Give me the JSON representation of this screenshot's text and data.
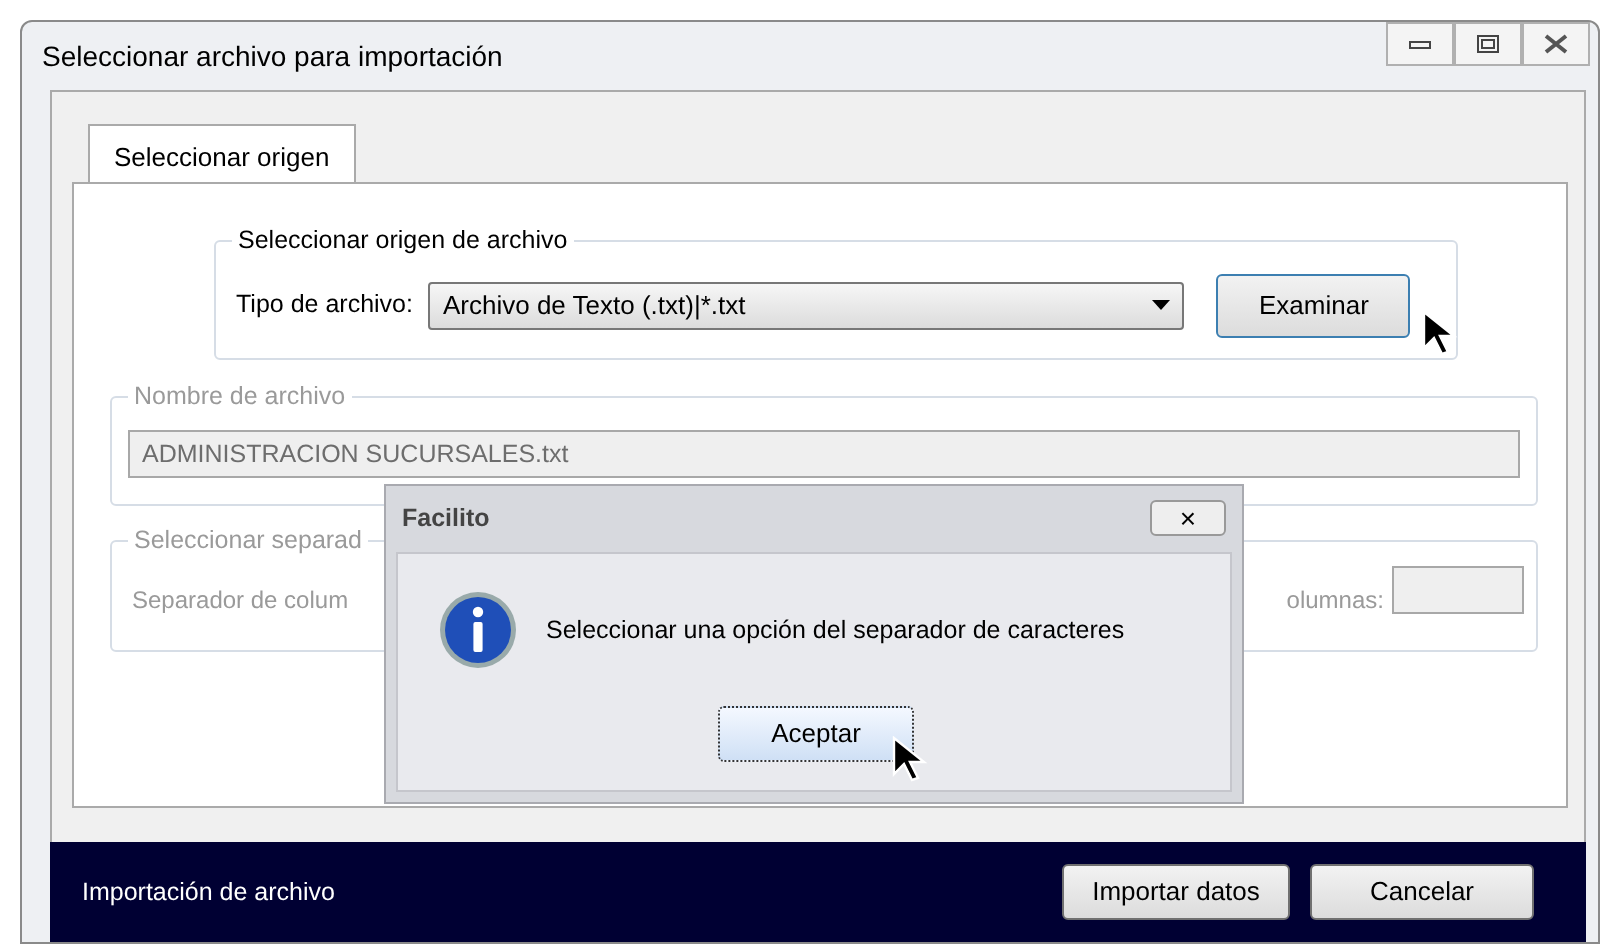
{
  "window": {
    "title": "Seleccionar archivo para importación"
  },
  "tabs": [
    {
      "label": "Seleccionar origen",
      "selected": true
    }
  ],
  "source_group": {
    "title": "Seleccionar origen de archivo",
    "file_type_label": "Tipo de archivo:",
    "file_type_value": "Archivo de Texto (.txt)|*.txt",
    "browse_button": "Examinar"
  },
  "file_name_group": {
    "title": "Nombre de archivo",
    "value": "ADMINISTRACION SUCURSALES.txt",
    "disabled": true
  },
  "separator_group": {
    "title": "Seleccionar separad",
    "column_separator_label": "Separador de colum",
    "columns_label": "olumnas:",
    "disabled": true
  },
  "dialog": {
    "title": "Facilito",
    "close": "×",
    "message": "Seleccionar una opción del separador de caracteres",
    "button": "Aceptar"
  },
  "status_bar": {
    "text": "Importación de archivo",
    "buttons": [
      "Importar datos",
      "Cancelar"
    ]
  }
}
